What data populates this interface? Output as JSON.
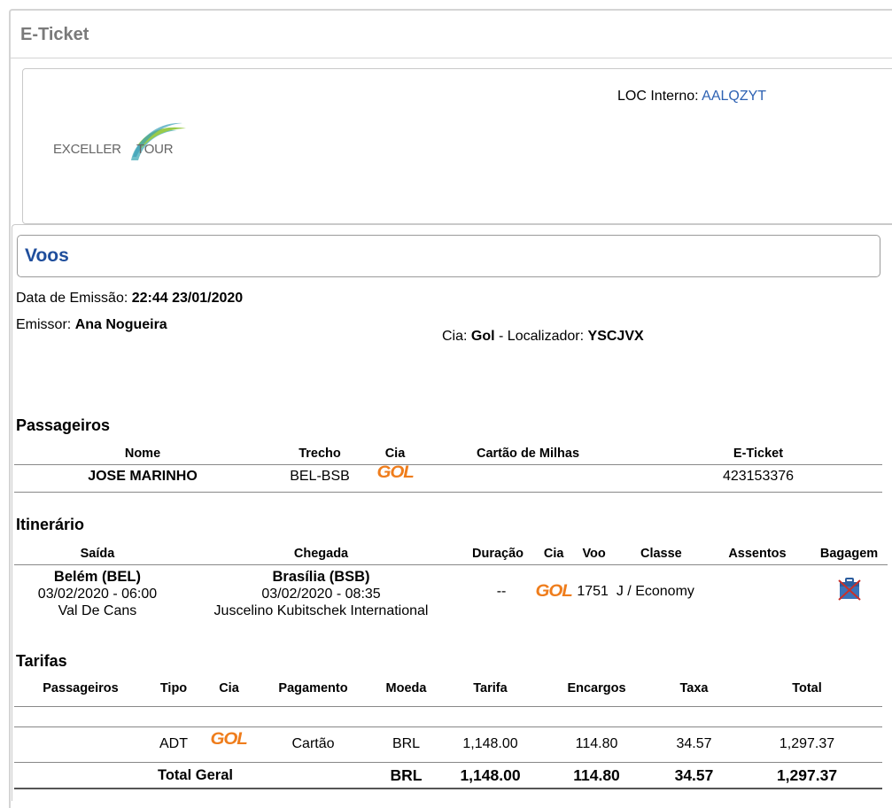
{
  "window": {
    "title": "E-Ticket"
  },
  "header": {
    "loc_label": "LOC Interno:",
    "loc_value": "AALQZYT",
    "logo": {
      "left": "EXCELLER",
      "right": "TOUR"
    }
  },
  "voos": {
    "title": "Voos",
    "emissao_label": "Data de Emissão:",
    "emissao_value": "22:44 23/01/2020",
    "emissor_label": "Emissor:",
    "emissor_value": "Ana Nogueira",
    "cia_label": "Cia:",
    "cia_value": "Gol",
    "localizador_label": " - Localizador:",
    "localizador_value": "YSCJVX"
  },
  "passageiros": {
    "title": "Passageiros",
    "headers": [
      "Nome",
      "Trecho",
      "Cia",
      "Cartão de Milhas",
      "E-Ticket"
    ],
    "rows": [
      {
        "nome": "JOSE MARINHO",
        "trecho": "BEL-BSB",
        "cia_logo": "GOL",
        "cartao": "",
        "eticket": "423153376"
      }
    ]
  },
  "itinerario": {
    "title": "Itinerário",
    "headers": [
      "Saída",
      "Chegada",
      "Duração",
      "Cia",
      "Voo",
      "Classe",
      "Assentos",
      "Bagagem"
    ],
    "rows": [
      {
        "saida_city": "Belém (BEL)",
        "saida_time": "03/02/2020 - 06:00",
        "saida_airport": "Val De Cans",
        "chegada_city": "Brasília (BSB)",
        "chegada_time": "03/02/2020 - 08:35",
        "chegada_airport": "Juscelino Kubitschek International",
        "duracao": "--",
        "cia_logo": "GOL",
        "voo": "1751",
        "classe": "J / Economy",
        "assentos": "",
        "bagagem_icon": "no-baggage-icon"
      }
    ]
  },
  "tarifas": {
    "title": "Tarifas",
    "headers": [
      "Passageiros",
      "Tipo",
      "Cia",
      "Pagamento",
      "Moeda",
      "Tarifa",
      "Encargos",
      "Taxa",
      "Total"
    ],
    "rows": [
      {
        "passageiros": "",
        "tipo": "ADT",
        "cia_logo": "GOL",
        "pagamento": "Cartão",
        "moeda": "BRL",
        "tarifa": "1,148.00",
        "encargos": "114.80",
        "taxa": "34.57",
        "total": "1,297.37"
      }
    ],
    "total": {
      "label": "Total Geral",
      "moeda": "BRL",
      "tarifa": "1,148.00",
      "encargos": "114.80",
      "taxa": "34.57",
      "total": "1,297.37"
    }
  },
  "colors": {
    "link": "#2e62b3",
    "section_title": "#1f4e9c",
    "gol_orange": "#ef7d1c"
  }
}
